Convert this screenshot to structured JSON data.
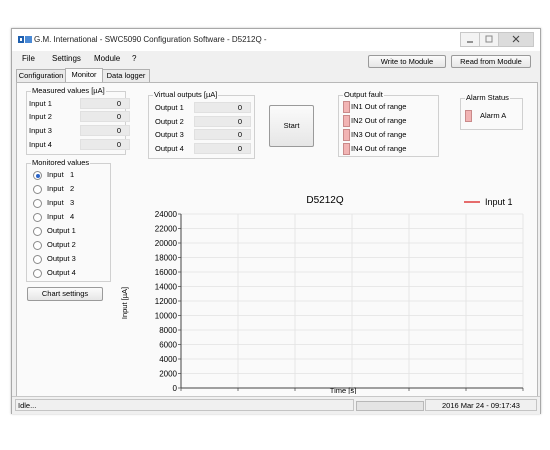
{
  "window": {
    "title": "G.M. International - SWC5090 Configuration Software - D5212Q -",
    "icon": "gm-logo-icon"
  },
  "menu": [
    "File",
    "Settings",
    "Module",
    "?"
  ],
  "toolbar": {
    "write_label": "Write to Module",
    "read_label": "Read from Module"
  },
  "tabs": [
    {
      "label": "Configuration",
      "active": false
    },
    {
      "label": "Monitor",
      "active": true
    },
    {
      "label": "Data logger",
      "active": false
    }
  ],
  "measured": {
    "title": "Measured values [µA]",
    "rows": [
      {
        "label": "Input 1",
        "value": "0"
      },
      {
        "label": "Input 2",
        "value": "0"
      },
      {
        "label": "Input 3",
        "value": "0"
      },
      {
        "label": "Input 4",
        "value": "0"
      }
    ]
  },
  "virtual": {
    "title": "Virtual outputs [µA]",
    "rows": [
      {
        "label": "Output 1",
        "value": "0"
      },
      {
        "label": "Output 2",
        "value": "0"
      },
      {
        "label": "Output 3",
        "value": "0"
      },
      {
        "label": "Output 4",
        "value": "0"
      }
    ]
  },
  "start_label": "Start",
  "fault": {
    "title": "Output fault",
    "items": [
      "IN1 Out of range",
      "IN2 Out of range",
      "IN3 Out of range",
      "IN4 Out of range"
    ],
    "led_color": "#f2b4b4"
  },
  "alarm": {
    "title": "Alarm Status",
    "item": "Alarm A"
  },
  "monitored": {
    "title": "Monitored values",
    "options": [
      {
        "label": "Input",
        "num": "1",
        "checked": true
      },
      {
        "label": "Input",
        "num": "2",
        "checked": false
      },
      {
        "label": "Input",
        "num": "3",
        "checked": false
      },
      {
        "label": "Input",
        "num": "4",
        "checked": false
      },
      {
        "label": "Output 1",
        "num": "",
        "checked": false
      },
      {
        "label": "Output 2",
        "num": "",
        "checked": false
      },
      {
        "label": "Output 3",
        "num": "",
        "checked": false
      },
      {
        "label": "Output 4",
        "num": "",
        "checked": false
      }
    ]
  },
  "chart_settings_label": "Chart settings",
  "chart_data": {
    "type": "line",
    "title": "D5212Q",
    "xlabel": "Time [s]",
    "ylabel": "Input [µA]",
    "xlim": [
      0,
      180
    ],
    "ylim": [
      0,
      24000
    ],
    "x_ticks": [
      0,
      30,
      60,
      90,
      120,
      150,
      180
    ],
    "y_ticks": [
      0,
      2000,
      4000,
      6000,
      8000,
      10000,
      12000,
      14000,
      16000,
      18000,
      20000,
      22000,
      24000
    ],
    "grid": true,
    "legend_position": "top-right",
    "series": [
      {
        "name": "Input 1",
        "color": "#e03c3c",
        "x": [],
        "y": []
      }
    ]
  },
  "status": {
    "text": "Idle...",
    "datetime": "2016 Mar 24 - 09:17:43",
    "progress": 0
  }
}
